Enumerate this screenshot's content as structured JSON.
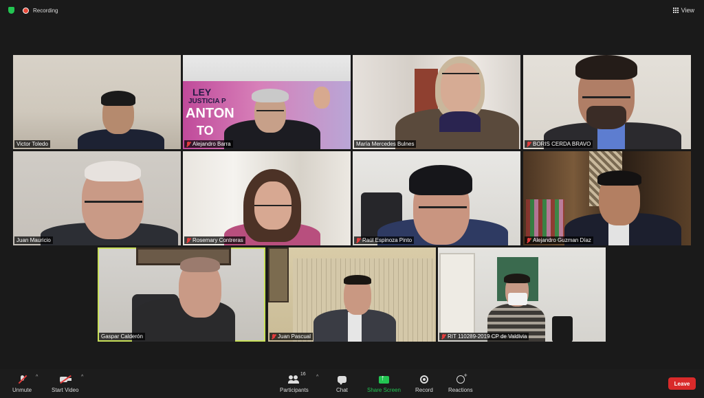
{
  "topbar": {
    "recording_label": "Recording",
    "view_label": "View"
  },
  "participants": [
    {
      "name": "Victor Toledo",
      "muted": false
    },
    {
      "name": "Alejandro Barra",
      "muted": true
    },
    {
      "name": "María Mercedes Bulnes",
      "muted": false
    },
    {
      "name": "BORIS CERDA BRAVO",
      "muted": true
    },
    {
      "name": "Juan Mauricio",
      "muted": false
    },
    {
      "name": "Rosemary Contreras",
      "muted": true
    },
    {
      "name": "Raúl Espinoza Pinto",
      "muted": true
    },
    {
      "name": "Alejandro Guzman Díaz",
      "muted": true
    },
    {
      "name": "Gaspar  Calderón",
      "muted": false,
      "active_speaker": true
    },
    {
      "name": "Juan Pascual",
      "muted": true
    },
    {
      "name": "RIT 110289-2019 CP de Valdivia",
      "muted": true
    }
  ],
  "banner_text": {
    "line1": "LEY",
    "line2": "JUSTICIA P",
    "line3": "ANTON",
    "line4": "TO"
  },
  "toolbar": {
    "unmute_label": "Unmute",
    "start_video_label": "Start Video",
    "participants_label": "Participants",
    "participants_count": "16",
    "chat_label": "Chat",
    "share_screen_label": "Share Screen",
    "record_label": "Record",
    "reactions_label": "Reactions",
    "leave_label": "Leave"
  },
  "colors": {
    "active_border": "#c8e05a",
    "share_green": "#23c552",
    "leave_red": "#d92a2a",
    "mute_red": "#e03c3c"
  }
}
